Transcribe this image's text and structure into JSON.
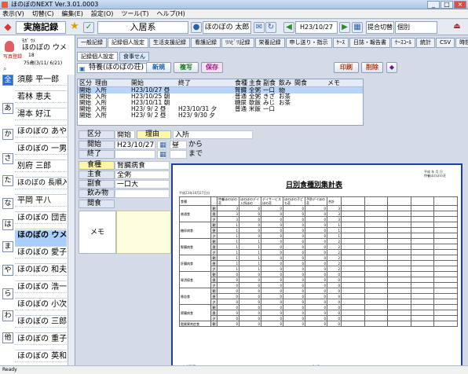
{
  "titlebar": {
    "title": "ほのぼのNEXT   Ver.3.01.0003"
  },
  "menu": [
    "表示(V)",
    "切替(C)",
    "編集(E)",
    "設定(O)",
    "ツール(T)",
    "ヘルプ(H)"
  ],
  "toolbar": {
    "record_label": "実施記録",
    "dept": "入居系",
    "user": "ほのぼの 太郎",
    "date": "H23/10/27",
    "switch_label": "提合切替",
    "switch_value": "個別"
  },
  "resident": {
    "kana_line": "ﾓｶﾞ ｳﾒ",
    "name": "ほのぼの ウメ",
    "room": "18",
    "age_line": "75歳(3/11/ 6/21)",
    "photo_label": "写真登録"
  },
  "tabs": [
    "一般記録",
    "記録個人設定",
    "生活支援記録",
    "看護記録",
    "ﾘﾊﾋﾞﾘ記録",
    "栄養記録",
    "申し送り・指示",
    "ｹｰｽ",
    "日誌・報告書",
    "ｹｰｽｺｰﾙ",
    "統計",
    "CSV",
    "時間軸記録"
  ],
  "subtabs": [
    "記録個人設定",
    "食事せん"
  ],
  "facility": "特養(ほのぼの荘)",
  "buttons": {
    "new": "新規",
    "copy": "複写",
    "save": "保存",
    "print": "印刷",
    "delete": "削除"
  },
  "kana_tabs": [
    "全",
    "あ",
    "か",
    "さ",
    "た",
    "な",
    "は",
    "ま",
    "や",
    "ら",
    "わ",
    "他"
  ],
  "patients": [
    "須藤 平一郎",
    "若林 恵夫",
    "湯本 好江",
    "ほのぼの あやこ",
    "ほのぼの 一男",
    "別府 三郎",
    "ほのぼの 長順入所",
    "平岡 平八",
    "ほのぼの 団吉",
    "ほのぼの ウメ",
    "ほのぼの 愛子",
    "ほのぼの 和夫",
    "ほのぼの 浩一郎",
    "ほのぼの 小次郎",
    "ほのぼの 三郎",
    "ほのぼの 重子",
    "ほのぼの 英和"
  ],
  "table": {
    "headers": [
      "区分",
      "理由",
      "開始",
      "終了",
      "",
      "食種",
      "主食",
      "副食",
      "飲み物",
      "間食",
      "メモ"
    ],
    "rows": [
      [
        "開始",
        "入所",
        "H23/10/27 昼",
        "",
        "",
        "腎臓",
        "全粥",
        "一口",
        "",
        "",
        ""
      ],
      [
        "開始",
        "入所",
        "H23/10/25 朝",
        "",
        "",
        "普通",
        "全粥",
        "きざ",
        "お茶",
        "",
        ""
      ],
      [
        "開始",
        "入所",
        "H23/10/11 朝",
        "",
        "",
        "糖尿",
        "軟飯",
        "みじ",
        "お茶",
        "",
        ""
      ],
      [
        "開始",
        "入所",
        "H23/ 9/ 2 昼",
        "H23/10/31 夕",
        "",
        "普通",
        "米飯",
        "一口",
        "",
        "",
        ""
      ],
      [
        "開始",
        "入所",
        "H23/ 9/ 2 昼",
        "H23/ 9/30 夕",
        "",
        "",
        "",
        "",
        "",
        "",
        ""
      ]
    ]
  },
  "form": {
    "kubun_label": "区分",
    "kubun_value": "開始",
    "reason_label": "理由",
    "reason_value": "入所",
    "start_label": "開始",
    "start_date": "H23/10/27",
    "start_meal": "昼",
    "from": "から",
    "end_label": "終了",
    "until": "まで",
    "shokushu_label": "食種",
    "shokushu_value": "腎臓病食",
    "shushoku_label": "主食",
    "shushoku_value": "全粥",
    "fukushoku_label": "副食",
    "fukushoku_value": "一口大",
    "nomimono_label": "飲み物",
    "kanshoku_label": "間食",
    "memo_label": "メモ"
  },
  "report": {
    "title": "日別食種別集計表",
    "date_line": "平成23年10月27日分",
    "org_line1": "平成 年 月 日",
    "org_line2": "特養ほのぼの荘",
    "columns": [
      "食種",
      "",
      "特養ほのぼの荘",
      "ほのぼのデイ入所ほの",
      "デイサービスほの荘",
      "ほのぼの子ども荘",
      "予防デイほの荘",
      "合計"
    ],
    "sections": [
      {
        "name": "普通食",
        "rows": [
          [
            "朝",
            "3",
            "0",
            "0",
            "0",
            "0",
            "3"
          ],
          [
            "昼",
            "3",
            "0",
            "0",
            "0",
            "0",
            "3"
          ],
          [
            "夕",
            "3",
            "0",
            "0",
            "0",
            "0",
            "3"
          ]
        ]
      },
      {
        "name": "糖尿病食",
        "rows": [
          [
            "朝",
            "1",
            "0",
            "0",
            "0",
            "0",
            "1"
          ],
          [
            "昼",
            "1",
            "0",
            "0",
            "0",
            "0",
            "1"
          ],
          [
            "夕",
            "1",
            "0",
            "0",
            "0",
            "0",
            "1"
          ]
        ]
      },
      {
        "name": "腎臓病食",
        "rows": [
          [
            "朝",
            "1",
            "1",
            "0",
            "0",
            "0",
            "2"
          ],
          [
            "昼",
            "1",
            "1",
            "0",
            "0",
            "0",
            "2"
          ],
          [
            "夕",
            "1",
            "1",
            "0",
            "0",
            "0",
            "2"
          ]
        ]
      },
      {
        "name": "肝臓病食",
        "rows": [
          [
            "朝",
            "1",
            "1",
            "0",
            "0",
            "0",
            "2"
          ],
          [
            "昼",
            "1",
            "1",
            "0",
            "0",
            "0",
            "2"
          ],
          [
            "夕",
            "1",
            "1",
            "0",
            "0",
            "0",
            "2"
          ]
        ]
      },
      {
        "name": "胃潰瘍食",
        "rows": [
          [
            "朝",
            "0",
            "0",
            "0",
            "0",
            "0",
            "0"
          ],
          [
            "昼",
            "0",
            "0",
            "0",
            "0",
            "0",
            "0"
          ],
          [
            "夕",
            "0",
            "0",
            "0",
            "0",
            "0",
            "0"
          ]
        ]
      },
      {
        "name": "貧血食",
        "rows": [
          [
            "朝",
            "0",
            "0",
            "0",
            "0",
            "0",
            "0"
          ],
          [
            "昼",
            "0",
            "0",
            "0",
            "0",
            "0",
            "0"
          ],
          [
            "夕",
            "0",
            "0",
            "0",
            "0",
            "0",
            "0"
          ]
        ]
      },
      {
        "name": "膵臓病食",
        "rows": [
          [
            "朝",
            "0",
            "0",
            "0",
            "0",
            "0",
            "0"
          ],
          [
            "昼",
            "0",
            "0",
            "0",
            "0",
            "0",
            "0"
          ],
          [
            "夕",
            "0",
            "0",
            "0",
            "0",
            "0",
            "0"
          ]
        ]
      },
      {
        "name": "脂質異常症食",
        "rows": [
          [
            "朝",
            "0",
            "0",
            "0",
            "0",
            "0",
            "0"
          ]
        ]
      }
    ],
    "footer_left": "ﾎﾉﾎﾞﾉNEXT",
    "footer_page": "1 / 2"
  },
  "status": "Ready"
}
